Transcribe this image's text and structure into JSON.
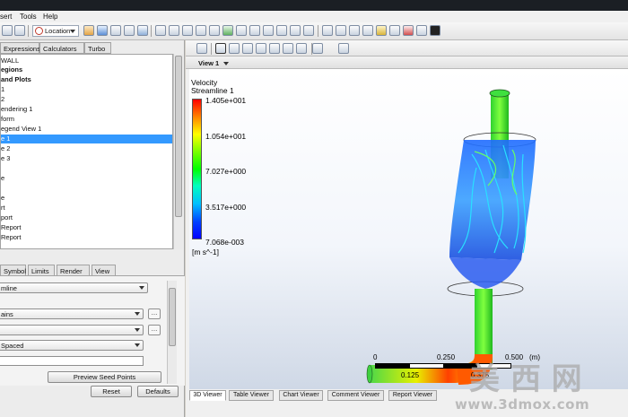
{
  "menu": {
    "insert": "sert",
    "tools": "Tools",
    "help": "Help"
  },
  "toolbar": {
    "location_label": "Location"
  },
  "left_tabs": [
    "Expressions",
    "Calculators",
    "Turbo"
  ],
  "tree": [
    {
      "label": "WALL",
      "bold": false,
      "selected": false
    },
    {
      "label": "egions",
      "bold": true,
      "selected": false
    },
    {
      "label": "and Plots",
      "bold": true,
      "selected": false
    },
    {
      "label": "1",
      "bold": false,
      "selected": false
    },
    {
      "label": "2",
      "bold": false,
      "selected": false
    },
    {
      "label": "endering 1",
      "bold": false,
      "selected": false
    },
    {
      "label": "form",
      "bold": false,
      "selected": false
    },
    {
      "label": "egend View 1",
      "bold": false,
      "selected": false
    },
    {
      "label": "e 1",
      "bold": false,
      "selected": true
    },
    {
      "label": "e 2",
      "bold": false,
      "selected": false
    },
    {
      "label": "e 3",
      "bold": false,
      "selected": false
    },
    {
      "label": "",
      "bold": false,
      "selected": false
    },
    {
      "label": "e",
      "bold": false,
      "selected": false
    },
    {
      "label": "",
      "bold": false,
      "selected": false
    },
    {
      "label": "e",
      "bold": false,
      "selected": false
    },
    {
      "label": "rt",
      "bold": false,
      "selected": false
    },
    {
      "label": "port",
      "bold": false,
      "selected": false
    },
    {
      "label": "Report",
      "bold": false,
      "selected": false
    },
    {
      "label": "Report",
      "bold": false,
      "selected": false
    }
  ],
  "detail_tabs": [
    "Symbol",
    "Limits",
    "Render",
    "View"
  ],
  "details": {
    "field1": "mline",
    "field2": "ains",
    "field3": "",
    "field4": "Spaced",
    "preview_label": "Preview Seed Points"
  },
  "buttons": {
    "reset": "Reset",
    "defaults": "Defaults"
  },
  "viewer": {
    "view_label": "View 1"
  },
  "legend": {
    "title": "Velocity",
    "subtitle": "Streamline 1",
    "values": [
      "1.405e+001",
      "1.054e+001",
      "7.027e+000",
      "3.517e+000",
      "7.068e-003"
    ],
    "unit": "[m s^-1]"
  },
  "scale": {
    "top_labels": [
      "0",
      "0.250",
      "0.500",
      "(m)"
    ],
    "bottom_labels": [
      "0.125",
      "0.375"
    ]
  },
  "bottom_tabs": [
    "3D Viewer",
    "Table Viewer",
    "Chart Viewer",
    "Comment Viewer",
    "Report Viewer"
  ],
  "watermark": {
    "chinese": "美 西 网",
    "url": "www.3dmox.com"
  },
  "colors": {
    "selection": "#3399ff",
    "background_top": "#ffffff",
    "background_bottom": "#cfd8e6"
  }
}
